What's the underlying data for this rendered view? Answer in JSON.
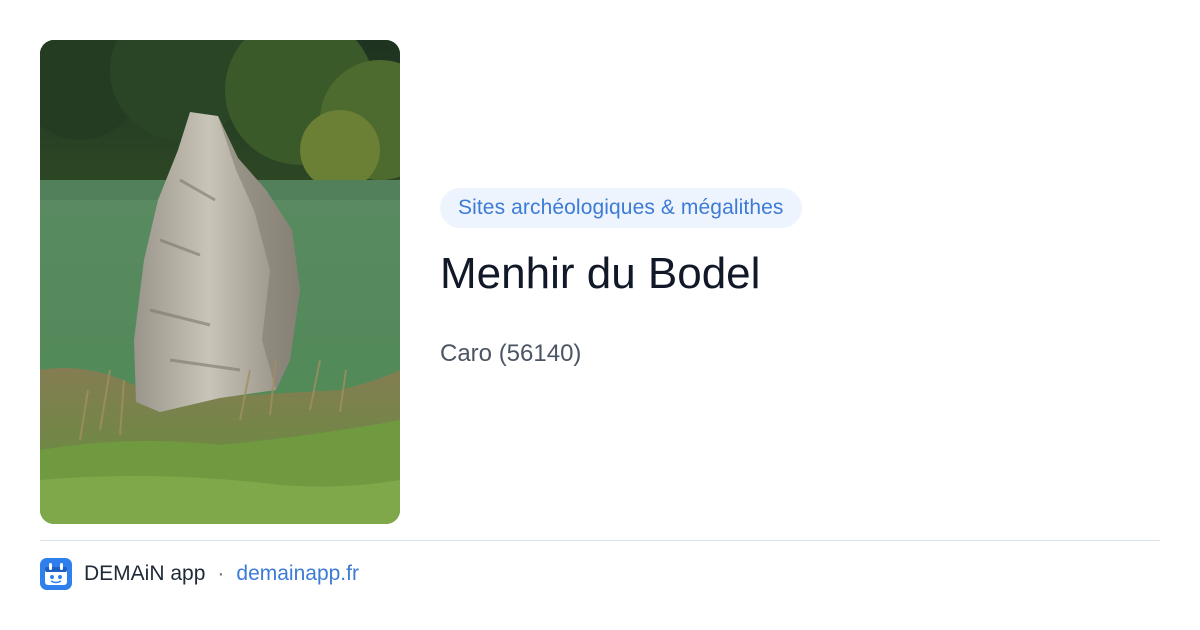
{
  "photo": {
    "subject": "menhir-standing-stone-photo"
  },
  "category": {
    "label": "Sites archéologiques & mégalithes"
  },
  "place": {
    "title": "Menhir du Bodel",
    "location": "Caro (56140)"
  },
  "footer": {
    "app_name": "DEMAiN app",
    "separator": "·",
    "site": "demainapp.fr",
    "icon": "demain-app-logo-icon"
  },
  "colors": {
    "accent": "#3c7bd6",
    "pill_background": "#eef4fd",
    "title": "#111827",
    "subtitle": "#4b5563",
    "app_icon": "#2f80ed"
  }
}
